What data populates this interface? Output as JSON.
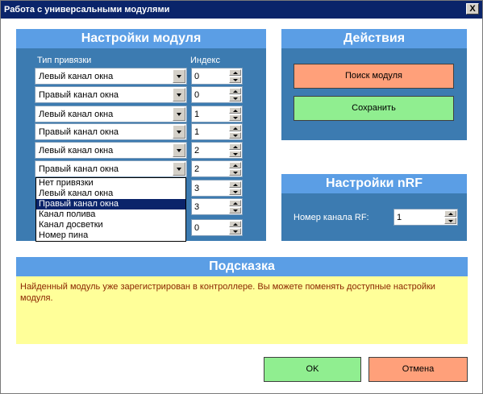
{
  "window": {
    "title": "Работа с универсальными модулями",
    "close_label": "X"
  },
  "module_settings": {
    "title": "Настройки модуля",
    "col_binding": "Тип привязки",
    "col_index": "Индекс",
    "rows": [
      {
        "binding": "Левый канал окна",
        "index": "0"
      },
      {
        "binding": "Правый канал окна",
        "index": "0"
      },
      {
        "binding": "Левый канал окна",
        "index": "1"
      },
      {
        "binding": "Правый канал окна",
        "index": "1"
      },
      {
        "binding": "Левый канал окна",
        "index": "2"
      },
      {
        "binding": "Правый канал окна",
        "index": "2"
      },
      {
        "binding": "",
        "index": "3"
      },
      {
        "binding": "",
        "index": "3"
      },
      {
        "binding": "",
        "index": "0"
      }
    ],
    "dropdown_options": [
      "Нет привязки",
      "Левый канал окна",
      "Правый канал окна",
      "Канал полива",
      "Канал досветки",
      "Номер пина"
    ],
    "dropdown_selected": "Правый канал окна"
  },
  "actions": {
    "title": "Действия",
    "search_label": "Поиск модуля",
    "save_label": "Сохранить"
  },
  "nrf": {
    "title": "Настройки nRF",
    "channel_label": "Номер канала RF:",
    "channel_value": "1"
  },
  "hint": {
    "title": "Подсказка",
    "text": "Найденный модуль уже зарегистрирован в контроллере. Вы можете поменять доступные настройки модуля."
  },
  "footer": {
    "ok_label": "OK",
    "cancel_label": "Отмена"
  },
  "colors": {
    "panel": "#3c7bb1",
    "header": "#5b9ee5",
    "orange": "#ffa07a",
    "green": "#90ee90",
    "hint_bg": "#ffff99"
  }
}
